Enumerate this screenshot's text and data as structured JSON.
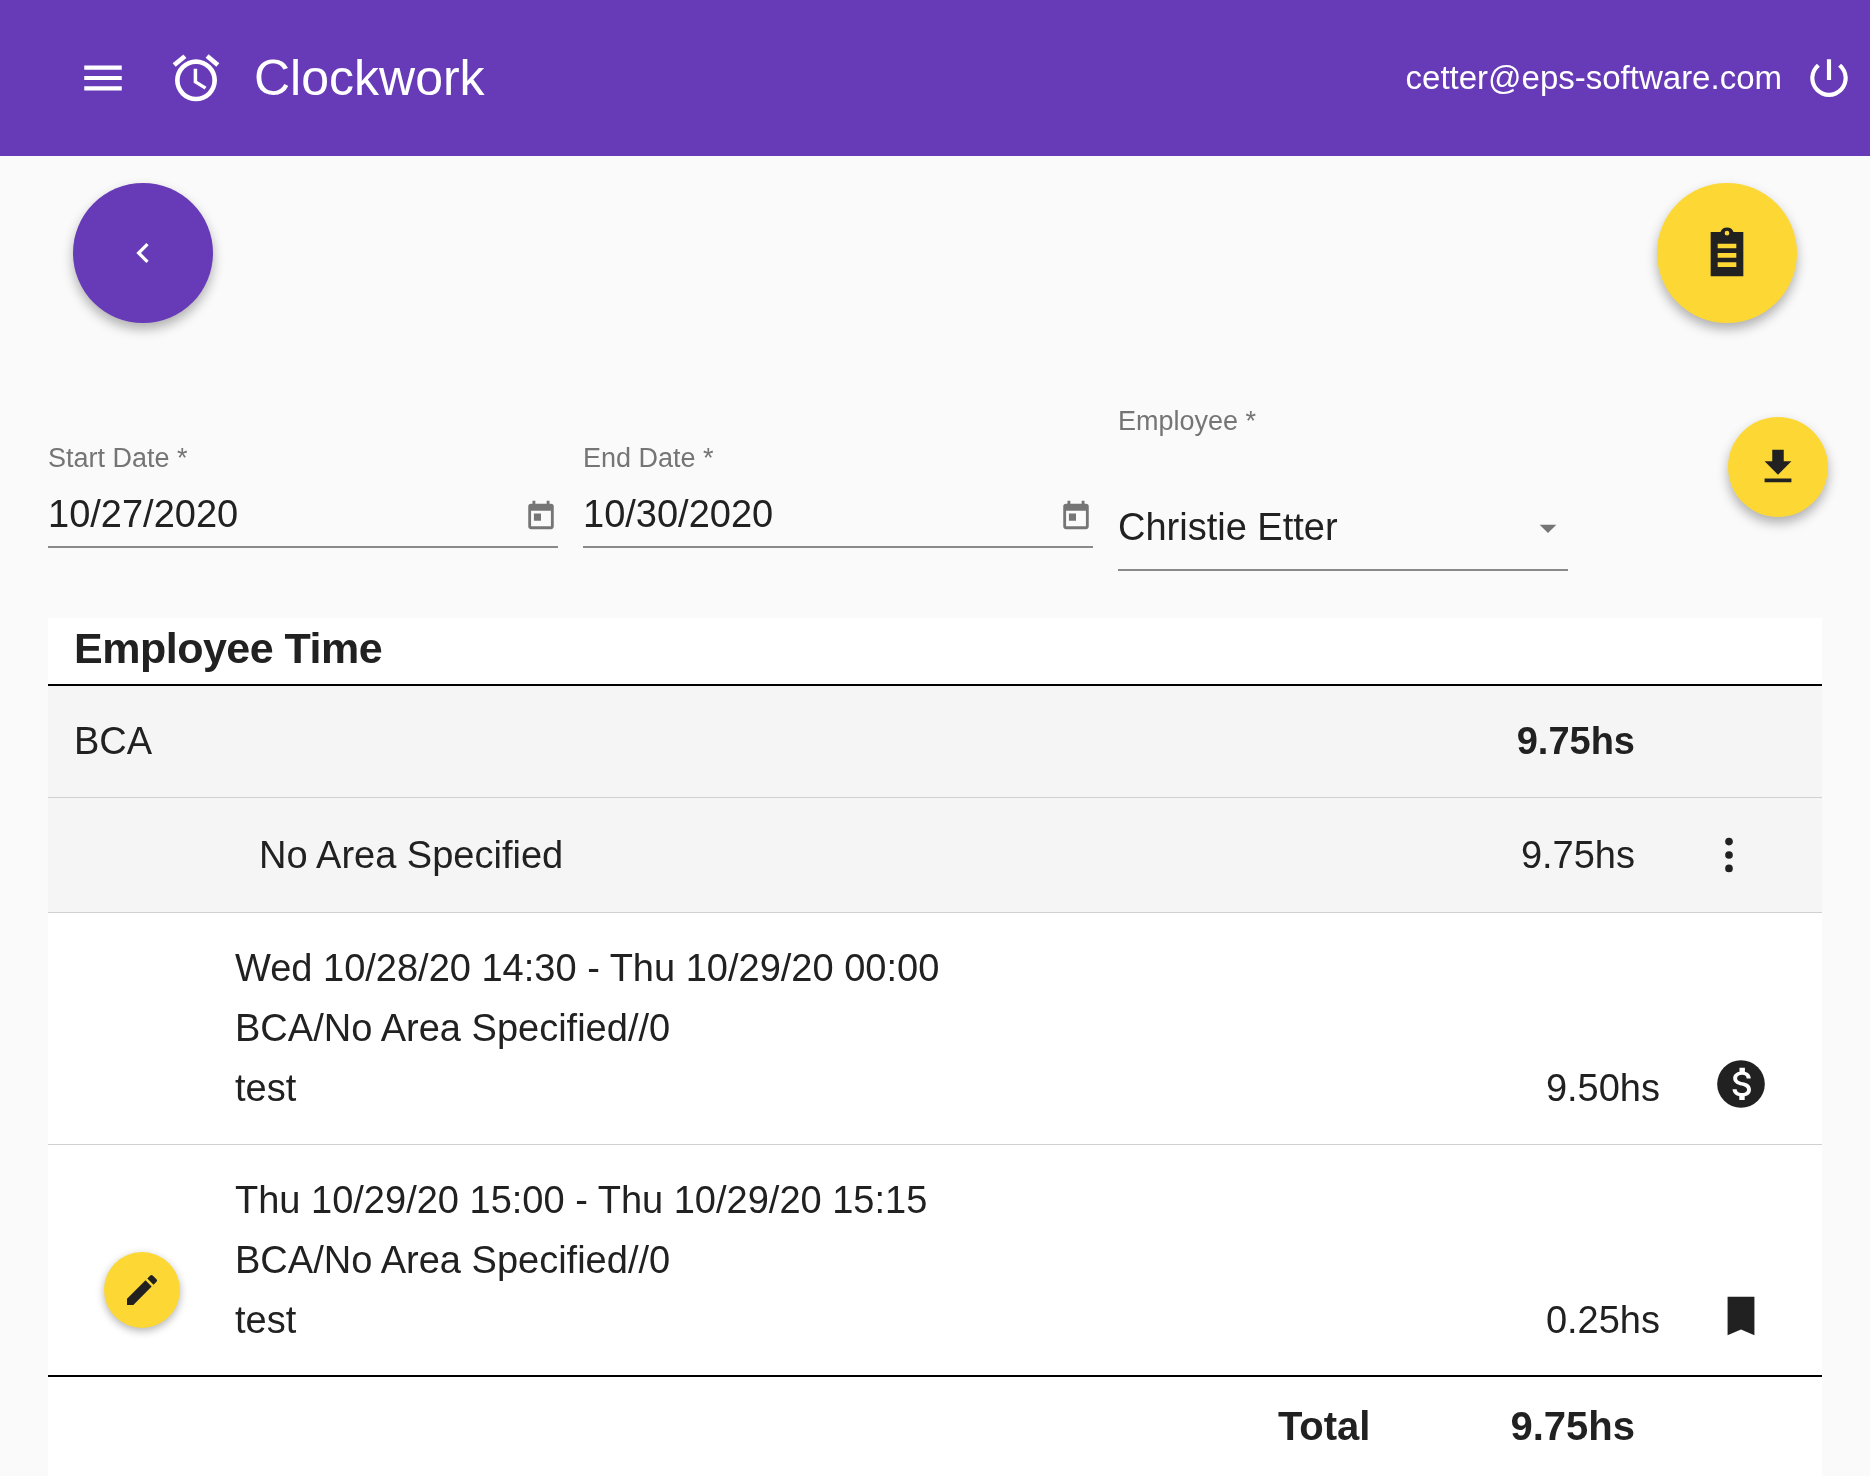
{
  "header": {
    "title": "Clockwork",
    "email": "cetter@eps-software.com"
  },
  "filters": [
    {
      "kind": "date",
      "label": "Start Date *",
      "value": "10/27/2020"
    },
    {
      "kind": "date",
      "label": "End Date *",
      "value": "10/30/2020"
    },
    {
      "kind": "select",
      "label": "Employee *",
      "value": "Christie Etter"
    }
  ],
  "report": {
    "title": "Employee Time",
    "groups": [
      {
        "name": "BCA",
        "hours": "9.75hs",
        "areas": [
          {
            "name": "No Area Specified",
            "hours": "9.75hs",
            "entries": [
              {
                "range": "Wed 10/28/20 14:30 - Thu 10/29/20 00:00",
                "path": "BCA/No Area Specified//0",
                "note": "test",
                "hours": "9.50hs",
                "kind": "dollar",
                "editable": false
              },
              {
                "range": "Thu 10/29/20 15:00 - Thu 10/29/20 15:15",
                "path": "BCA/No Area Specified//0",
                "note": "test",
                "hours": "0.25hs",
                "kind": "bookmark",
                "editable": true
              }
            ]
          }
        ]
      }
    ],
    "total_label": "Total",
    "total": "9.75hs"
  }
}
